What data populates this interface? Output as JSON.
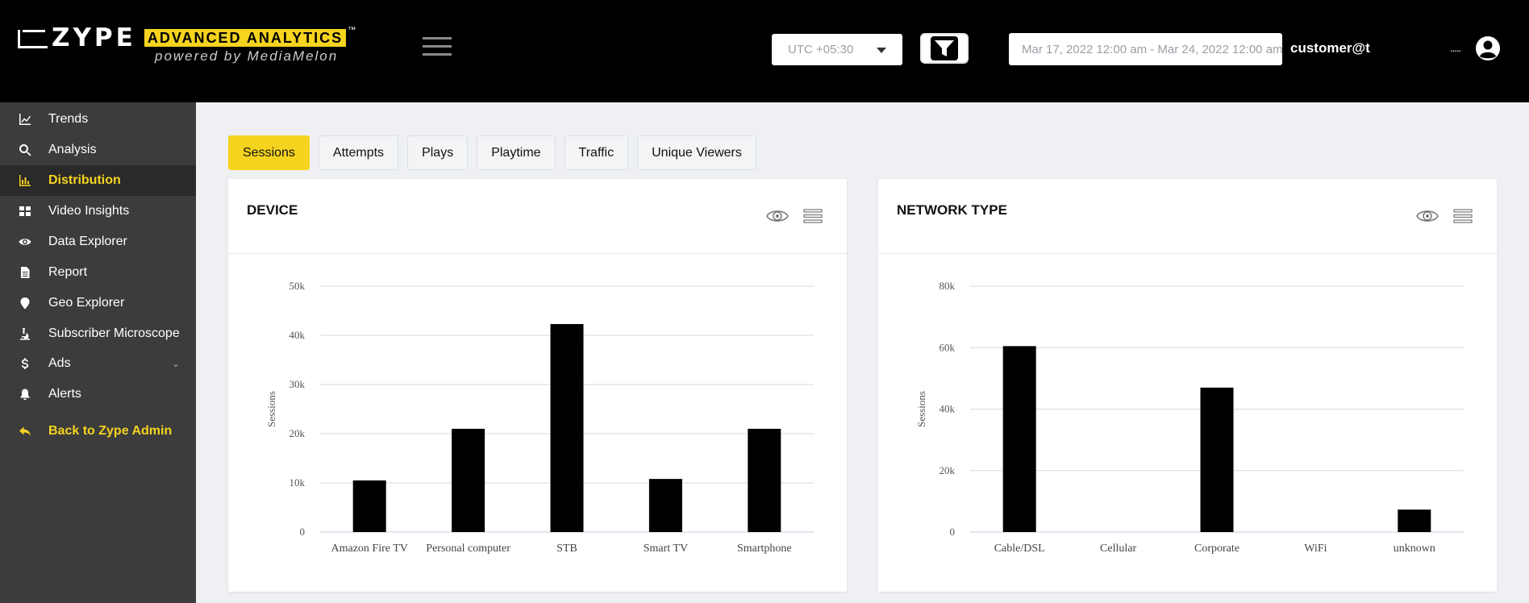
{
  "header": {
    "logo_text": "ZYPE",
    "logo_badge": "ADVANCED ANALYTICS",
    "logo_tm": "™",
    "logo_sub": "powered by MediaMelon",
    "timezone": "UTC +05:30",
    "date_range": "Mar 17, 2022 12:00 am - Mar 24, 2022 12:00 am",
    "user_email": "customer@t",
    "user_dots": "....."
  },
  "sidebar": {
    "items": [
      {
        "label": "Trends",
        "icon": "trends-icon"
      },
      {
        "label": "Analysis",
        "icon": "search-icon"
      },
      {
        "label": "Distribution",
        "icon": "bar-chart-icon",
        "active": true
      },
      {
        "label": "Video Insights",
        "icon": "grid-icon"
      },
      {
        "label": "Data Explorer",
        "icon": "eye-icon"
      },
      {
        "label": "Report",
        "icon": "document-icon"
      },
      {
        "label": "Geo Explorer",
        "icon": "map-pin-icon"
      },
      {
        "label": "Subscriber Microscope",
        "icon": "microscope-icon"
      },
      {
        "label": "Ads",
        "icon": "dollar-icon",
        "expandable": true
      },
      {
        "label": "Alerts",
        "icon": "bell-icon"
      }
    ],
    "back_label": "Back to Zype Admin"
  },
  "tabs": [
    "Sessions",
    "Attempts",
    "Plays",
    "Playtime",
    "Traffic",
    "Unique Viewers"
  ],
  "active_tab": "Sessions",
  "colors": {
    "accent": "#f5d31e",
    "header_bg": "#000000",
    "sidebar_bg": "#3c3c3c",
    "bar": "#000000"
  },
  "chart_data": [
    {
      "type": "bar",
      "title": "DEVICE",
      "ylabel": "Sessions",
      "categories": [
        "Amazon Fire TV",
        "Personal computer",
        "STB",
        "Smart TV",
        "Smartphone"
      ],
      "values": [
        10500,
        21000,
        42300,
        10800,
        21000
      ],
      "ylim": [
        0,
        50000
      ],
      "yticks": [
        0,
        10000,
        20000,
        30000,
        40000,
        50000
      ],
      "ytick_labels": [
        "0",
        "10k",
        "20k",
        "30k",
        "40k",
        "50k"
      ],
      "grid": true
    },
    {
      "type": "bar",
      "title": "NETWORK TYPE",
      "ylabel": "Sessions",
      "categories": [
        "Cable/DSL",
        "Cellular",
        "Corporate",
        "WiFi",
        "unknown"
      ],
      "values": [
        60500,
        0,
        47000,
        0,
        7300
      ],
      "ylim": [
        0,
        80000
      ],
      "yticks": [
        0,
        20000,
        40000,
        60000,
        80000
      ],
      "ytick_labels": [
        "0",
        "20k",
        "40k",
        "60k",
        "80k"
      ],
      "grid": true
    }
  ]
}
